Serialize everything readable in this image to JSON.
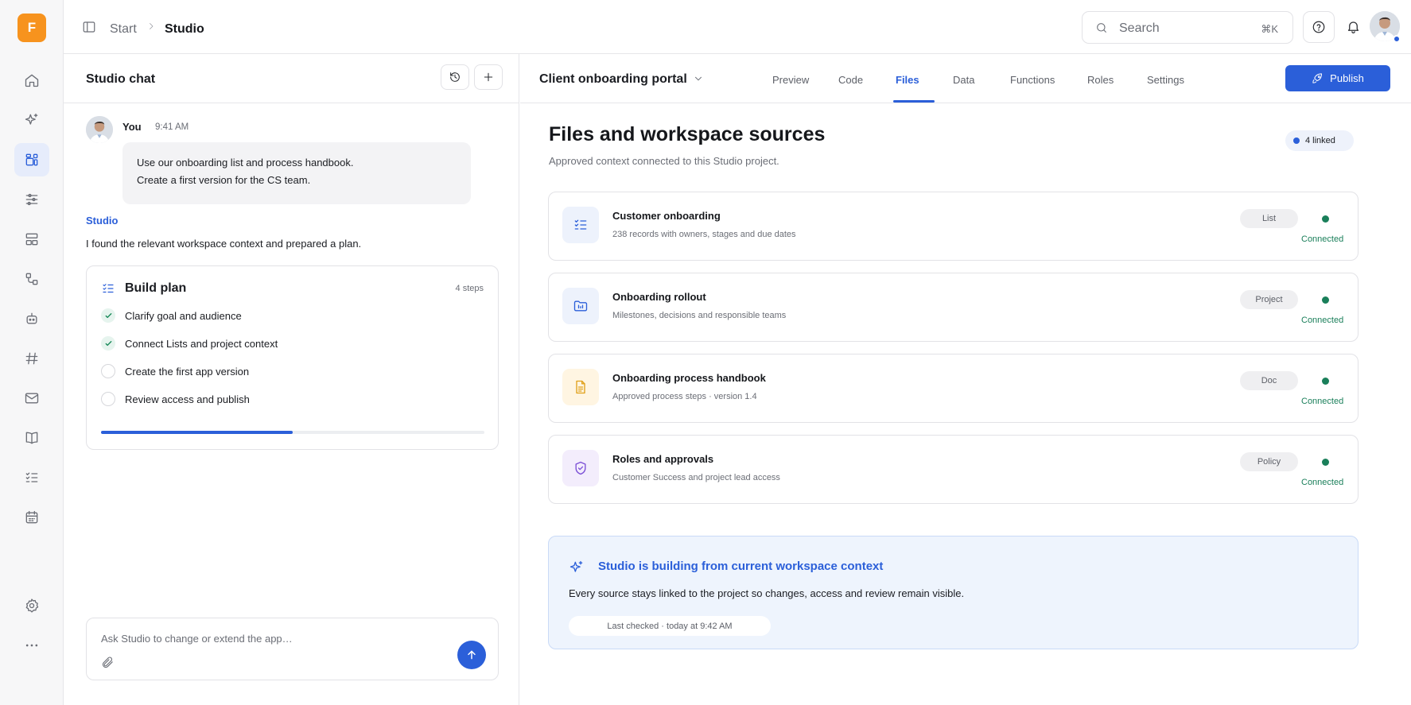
{
  "app": {
    "logo_letter": "F",
    "accent": "#2b5fd9",
    "logo_color": "#f7931e"
  },
  "rail": {
    "items": [
      {
        "name": "home-icon",
        "active": false
      },
      {
        "name": "sparkles-icon",
        "active": false
      },
      {
        "name": "studio-grid-icon",
        "active": true
      },
      {
        "name": "sliders-icon",
        "active": false
      },
      {
        "name": "layout-icon",
        "active": false
      },
      {
        "name": "flow-icon",
        "active": false
      },
      {
        "name": "bot-icon",
        "active": false
      },
      {
        "name": "hash-icon",
        "active": false
      },
      {
        "name": "mail-icon",
        "active": false
      },
      {
        "name": "book-icon",
        "active": false
      },
      {
        "name": "checklist-icon",
        "active": false
      },
      {
        "name": "calendar-icon",
        "active": false
      }
    ],
    "bottom": [
      {
        "name": "settings-icon"
      },
      {
        "name": "more-icon"
      }
    ]
  },
  "topbar": {
    "breadcrumb": {
      "start": "Start",
      "current": "Studio"
    },
    "search": {
      "placeholder": "Search",
      "shortcut": "⌘K"
    }
  },
  "chat": {
    "title": "Studio chat",
    "user_message": {
      "author": "You",
      "time": "9:41 AM",
      "line1": "Use our onboarding list and process handbook.",
      "line2": "Create a first version for the CS team."
    },
    "reply": {
      "author": "Studio",
      "text": "I found the relevant workspace context and prepared a plan."
    },
    "plan": {
      "title": "Build plan",
      "count": "4 steps",
      "steps": [
        {
          "label": "Clarify goal and audience",
          "done": true
        },
        {
          "label": "Connect Lists and project context",
          "done": true
        },
        {
          "label": "Create the first app version",
          "done": false
        },
        {
          "label": "Review access and publish",
          "done": false
        }
      ],
      "progress": 0.5
    },
    "composer": {
      "placeholder": "Ask Studio to change or extend the app…"
    }
  },
  "main": {
    "project_name": "Client onboarding portal",
    "tabs": [
      {
        "label": "Preview",
        "active": false
      },
      {
        "label": "Code",
        "active": false
      },
      {
        "label": "Files",
        "active": true
      },
      {
        "label": "Data",
        "active": false
      },
      {
        "label": "Functions",
        "active": false
      },
      {
        "label": "Roles",
        "active": false
      },
      {
        "label": "Settings",
        "active": false
      }
    ],
    "publish_label": "Publish",
    "title": "Files and workspace sources",
    "subtitle": "Approved context connected to this Studio project.",
    "linked_badge": "4 linked",
    "sources": [
      {
        "name": "Customer onboarding",
        "desc": "238 records with owners, stages and due dates",
        "type": "List",
        "status": "Connected",
        "icon": "checklist-icon",
        "tile_color": "#edf2fc"
      },
      {
        "name": "Onboarding rollout",
        "desc": "Milestones, decisions and responsible teams",
        "type": "Project",
        "status": "Connected",
        "icon": "folder-icon",
        "tile_color": "#edf2fc"
      },
      {
        "name": "Onboarding process handbook",
        "desc": "Approved process steps · version 1.4",
        "type": "Doc",
        "status": "Connected",
        "icon": "document-icon",
        "tile_color": "#fff5e2"
      },
      {
        "name": "Roles and approvals",
        "desc": "Customer Success and project lead access",
        "type": "Policy",
        "status": "Connected",
        "icon": "shield-check-icon",
        "tile_color": "#f3edfc"
      }
    ],
    "banner": {
      "title": "Studio is building from current workspace context",
      "text": "Every source stays linked to the project so changes, access and review remain visible.",
      "last_checked": "Last checked · today at 9:42 AM"
    }
  }
}
